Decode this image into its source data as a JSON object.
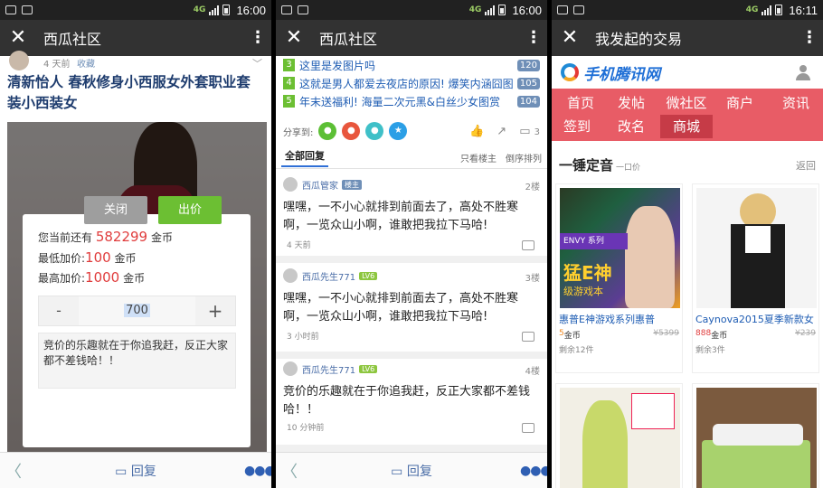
{
  "status": {
    "panel1_time": "16:00",
    "panel2_time": "16:00",
    "panel3_time": "16:11",
    "net_label": "4G"
  },
  "panel1": {
    "window_title": "西瓜社区",
    "post_meta": {
      "time": "4 天前",
      "favorite": "收藏"
    },
    "post_title": "清新怡人 春秋修身小西服女外套职业套装小西装女",
    "bid_dialog": {
      "balance_prefix": "您当前还有",
      "balance_value": "582299",
      "balance_unit": "金币",
      "min_prefix": "最低加价:",
      "min_value": "100",
      "min_unit": "金币",
      "max_prefix": "最高加价:",
      "max_value": "1000",
      "max_unit": "金币",
      "stepper_minus": "-",
      "stepper_value": "700",
      "stepper_plus": "+",
      "note": "竞价的乐趣就在于你追我赶，反正大家都不差钱哈！！",
      "close_label": "关闭",
      "bid_label": "出价"
    },
    "bottom": {
      "reply_label": "回复"
    }
  },
  "panel2": {
    "window_title": "西瓜社区",
    "hot_list": [
      {
        "num": "3",
        "text": "这里是发图片吗",
        "count": "120"
      },
      {
        "num": "4",
        "text": "这就是男人都爱去夜店的原因! 爆笑内涵囧图",
        "count": "105"
      },
      {
        "num": "5",
        "text": "年末送福利! 海量二次元黑&白丝少女图赏",
        "count": "104"
      }
    ],
    "share_label": "分享到:",
    "comment_count": "3",
    "reply_tabs": {
      "all": "全部回复",
      "owner_only": "只看楼主",
      "reverse": "倒序排列"
    },
    "posts": [
      {
        "author": "西瓜管家",
        "badge": "楼主",
        "floor": "2楼",
        "body": "嘿嘿，一不小心就排到前面去了，高处不胜寒啊，一览众山小啊，谁敢把我拉下马哈!",
        "time": "4 天前"
      },
      {
        "author": "西瓜先生771",
        "badge": "LV6",
        "floor": "3楼",
        "body": "嘿嘿，一不小心就排到前面去了，高处不胜寒啊，一览众山小啊，谁敢把我拉下马哈!",
        "time": "3 小时前"
      },
      {
        "author": "西瓜先生771",
        "badge": "LV6",
        "floor": "4楼",
        "body": "竞价的乐趣就在于你追我赶，反正大家都不差钱哈！！",
        "time": "10 分钟前"
      }
    ],
    "bottom": {
      "reply_label": "回复"
    }
  },
  "panel3": {
    "window_title": "我发起的交易",
    "brand_name": "手机腾讯网",
    "nav": [
      "首页",
      "发帖",
      "微社区",
      "商户",
      "资讯",
      "签到",
      "改名",
      "商城"
    ],
    "section_title": "一锤定音",
    "section_sub": "一口价",
    "section_back": "返回",
    "products": [
      {
        "name": "惠普E神游戏系列惠普",
        "price": "5",
        "unit": "金币",
        "old_price": "¥5399",
        "remaining": "剩余12件",
        "banner_series": "ENVY 系列",
        "banner_big": "猛E神",
        "banner_small": "级游戏本"
      },
      {
        "name": "Caynova2015夏季新款女",
        "price": "888",
        "unit": "金币",
        "old_price": "¥239",
        "remaining": "剩余3件"
      }
    ]
  }
}
